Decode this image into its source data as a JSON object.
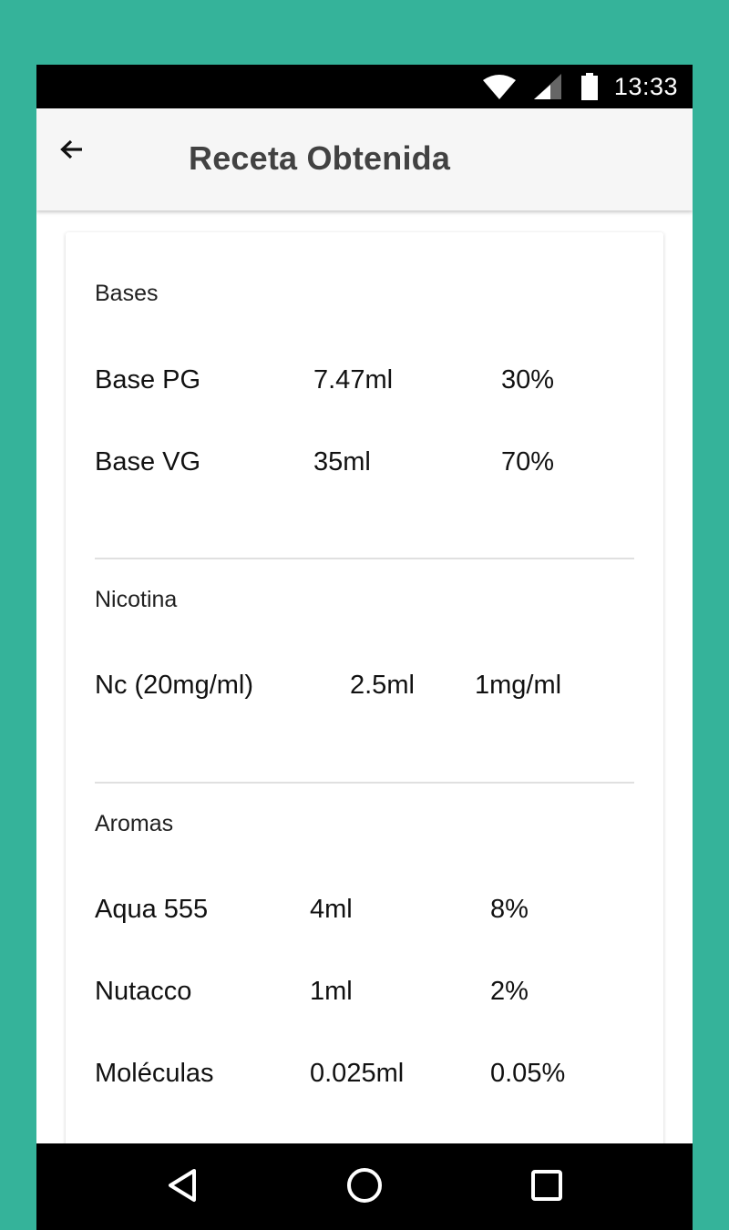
{
  "status_bar": {
    "time": "13:33",
    "icons": [
      "wifi-icon",
      "cell-signal-icon",
      "battery-icon"
    ]
  },
  "app_bar": {
    "back_icon": "arrow-back-icon",
    "title": "Receta Obtenida"
  },
  "sections": {
    "bases": {
      "title": "Bases",
      "rows": [
        {
          "name": "Base PG",
          "amount": "7.47ml",
          "value": "30%"
        },
        {
          "name": "Base VG",
          "amount": "35ml",
          "value": "70%"
        }
      ]
    },
    "nicotina": {
      "title": "Nicotina",
      "rows": [
        {
          "name": "Nc (20mg/ml)",
          "amount": "2.5ml",
          "value": "1mg/ml"
        }
      ]
    },
    "aromas": {
      "title": "Aromas",
      "rows": [
        {
          "name": "Aqua 555",
          "amount": "4ml",
          "value": "8%"
        },
        {
          "name": "Nutacco",
          "amount": "1ml",
          "value": "2%"
        },
        {
          "name": "Moléculas",
          "amount": "0.025ml",
          "value": "0.05%"
        }
      ]
    }
  },
  "nav_bar": {
    "icons": [
      "nav-back-icon",
      "nav-home-icon",
      "nav-recents-icon"
    ]
  },
  "colors": {
    "background": "#35b39a",
    "app_bar": "#f6f6f6",
    "title_text": "#424242",
    "status_bar": "#000000"
  }
}
